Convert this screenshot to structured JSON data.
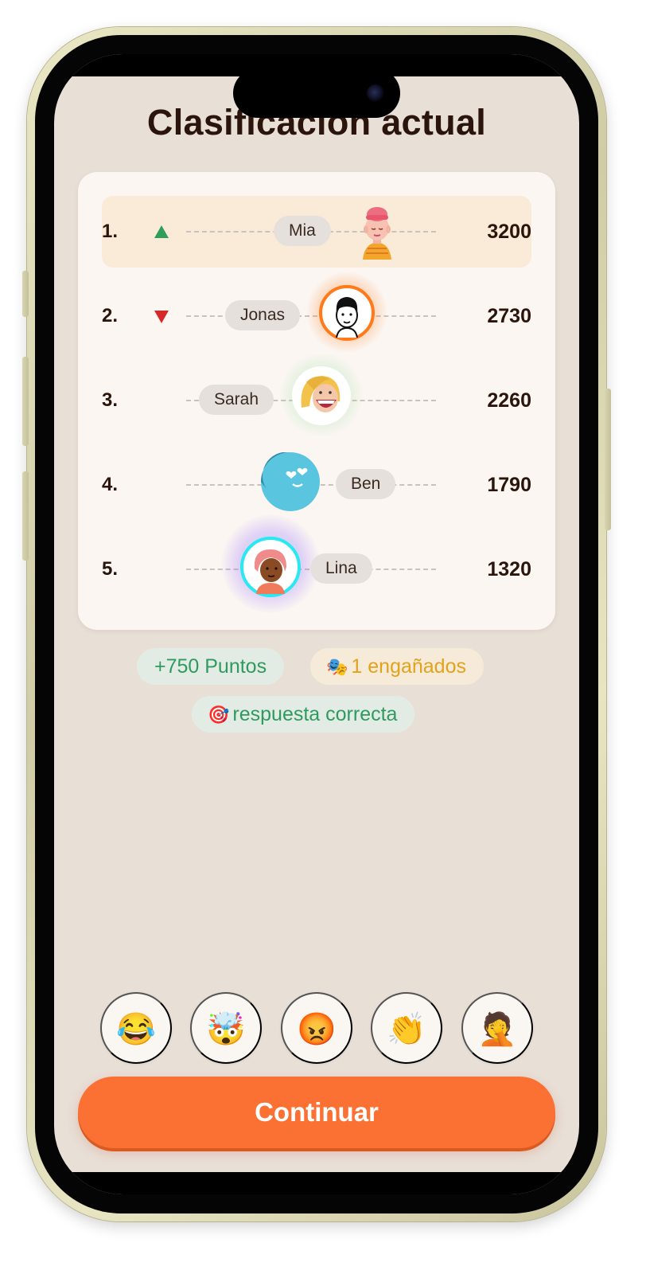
{
  "title": "Clasificación actual",
  "leaderboard": [
    {
      "rank": "1.",
      "trend": "up",
      "name": "Mia",
      "score": "3200",
      "avatar": "mia-avatar",
      "highlight": true
    },
    {
      "rank": "2.",
      "trend": "down",
      "name": "Jonas",
      "score": "2730",
      "avatar": "jonas-avatar",
      "glow": "#ff7a1a"
    },
    {
      "rank": "3.",
      "trend": "none",
      "name": "Sarah",
      "score": "2260",
      "avatar": "sarah-avatar",
      "glow": "#7ad98a"
    },
    {
      "rank": "4.",
      "trend": "none",
      "name": "Ben",
      "score": "1790",
      "avatar": "ben-avatar"
    },
    {
      "rank": "5.",
      "trend": "none",
      "name": "Lina",
      "score": "1320",
      "avatar": "lina-avatar",
      "glow": "#4fe3ff"
    }
  ],
  "chips": {
    "points": "+750 Puntos",
    "fooled_icon": "🎭",
    "fooled": "1 engañados",
    "correct_icon": "🎯",
    "correct": "respuesta correcta"
  },
  "reactions": [
    "😂",
    "🤯",
    "😡",
    "👏",
    "🤦"
  ],
  "continue_label": "Continuar",
  "colors": {
    "background": "#e8dfd7",
    "accent": "#fb7133",
    "up": "#2f9e5b",
    "down": "#d62828",
    "highlight_row": "#f9ebd7"
  }
}
